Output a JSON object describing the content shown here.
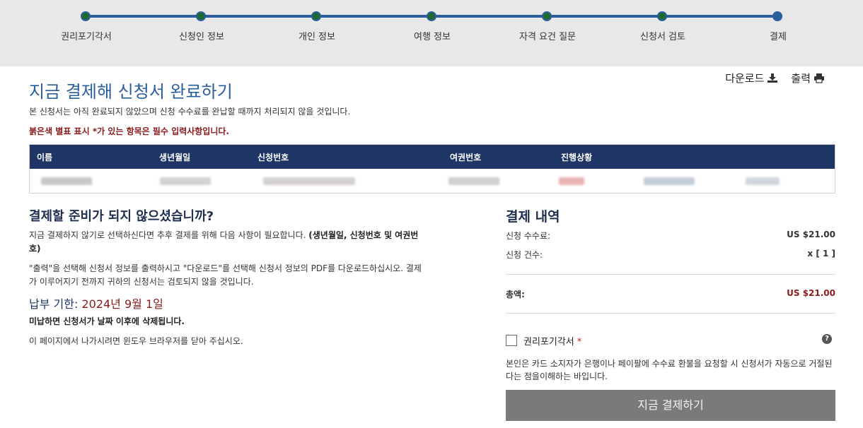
{
  "progress": {
    "steps": [
      {
        "label": "권리포기각서"
      },
      {
        "label": "신청인 정보"
      },
      {
        "label": "개인 정보"
      },
      {
        "label": "여행 정보"
      },
      {
        "label": "자격 요건 질문"
      },
      {
        "label": "신청서 검토"
      },
      {
        "label": "결제"
      }
    ]
  },
  "header": {
    "title": "지금 결제해 신청서 완료하기",
    "download_label": "다운로드",
    "print_label": "출력",
    "intro": "본 신청서는 아직 완료되지 않았으며 신청 수수료를 완납할 때까지 처리되지 않을 것입니다.",
    "required_note": "붉은색 별표 표시 *가 있는 항목은 필수 입력사항입니다."
  },
  "info_table": {
    "columns": [
      "이름",
      "생년월일",
      "신청번호",
      "여권번호",
      "진행상황"
    ]
  },
  "left": {
    "heading": "결제할 준비가 되지 않으셨습니까?",
    "p1_text": "지금 결제하지 않기로 선택하신다면 추후 결제를 위해 다음 사항이 필요합니다. ",
    "p1_bold": "(생년월일, 신청번호 및 여권번호)",
    "p2": "\"출력\"을 선택해 신청서 정보를 출력하시고 \"다운로드\"를 선택해 신청서 정보의 PDF를 다운로드하십시오. 결제가 이루어지기 전까지 귀하의 신청서는 검토되지 않을 것입니다.",
    "deadline_label": "납부 기한: ",
    "deadline_date": "2024년 9월 1일",
    "delete_note": "미납하면 신청서가 날짜 이후에 삭제됩니다.",
    "close_note": "이 페이지에서 나가시려면 윈도우 브라우저를 닫아 주십시오."
  },
  "summary": {
    "title": "결제 내역",
    "fee_label": "신청 수수료:",
    "fee_value": "US $21.00",
    "count_label": "신청 건수:",
    "count_value": "x [ 1 ]",
    "total_label": "총액:",
    "total_value": "US $21.00",
    "waiver_label": "권리포기각서",
    "waiver_required": "*",
    "help_glyph": "?",
    "waiver_text": "본인은 카드 소지자가 은행이나 페이팔에 수수료 환불을 요청할 시 신청서가 자동으로 거절된다는 점을이해하는 바입니다.",
    "pay_button": "지금 결제하기"
  },
  "colors": {
    "accent": "#2a5e9c",
    "table_header": "#1f3566",
    "required": "#8b1a1a",
    "step_done": "#1d6b2f"
  }
}
